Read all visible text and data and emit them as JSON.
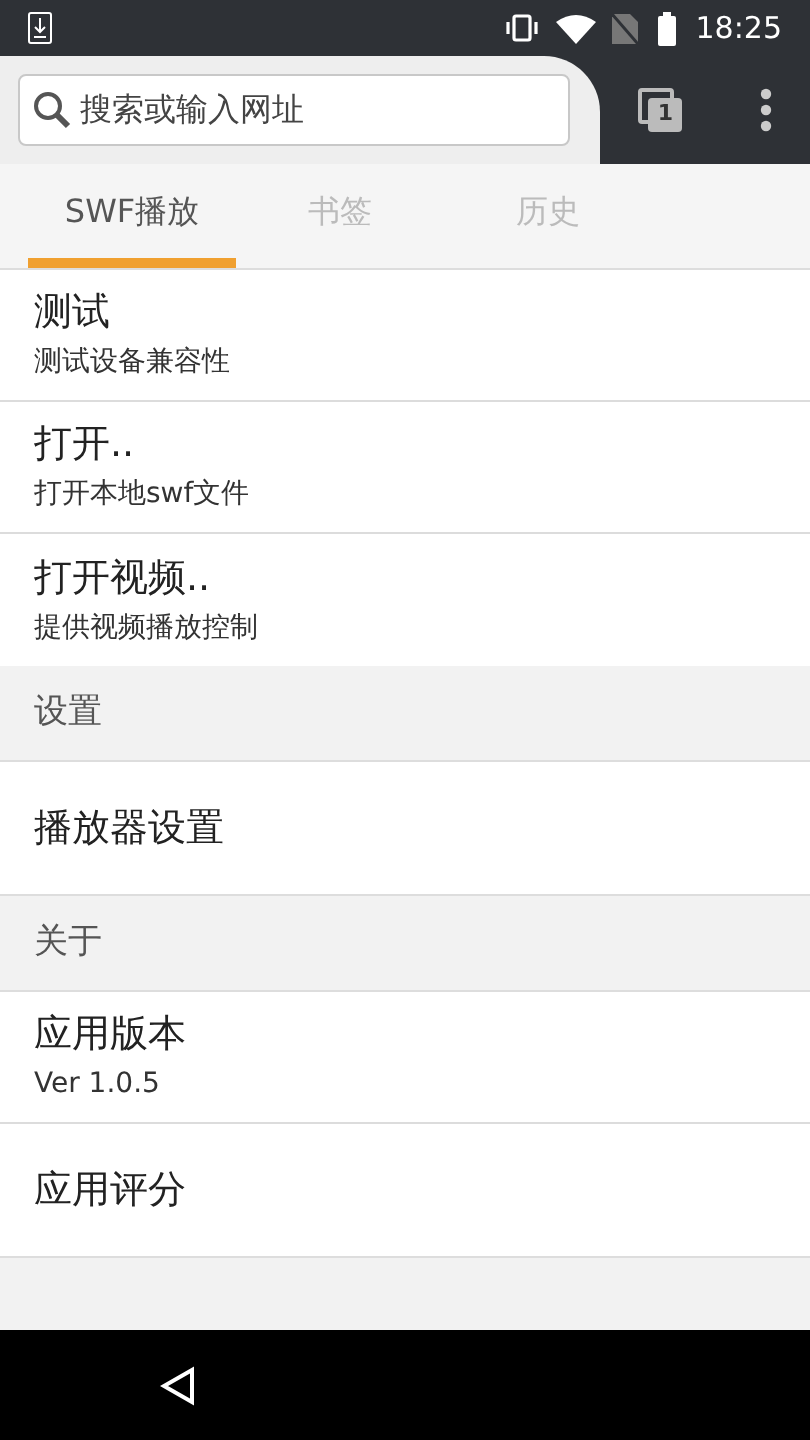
{
  "status_bar": {
    "time": "18:25"
  },
  "search": {
    "placeholder": "搜索或输入网址"
  },
  "tab_counter": "1",
  "tabs": [
    {
      "label": "SWF播放",
      "selected": true
    },
    {
      "label": "书签",
      "selected": false
    },
    {
      "label": "历史",
      "selected": false
    }
  ],
  "items": [
    {
      "title": "测试",
      "subtitle": "测试设备兼容性"
    },
    {
      "title": "打开..",
      "subtitle": "打开本地swf文件"
    },
    {
      "title": "打开视频..",
      "subtitle": "提供视频播放控制"
    }
  ],
  "sections": [
    {
      "header": "设置",
      "items": [
        {
          "title": "播放器设置"
        }
      ]
    },
    {
      "header": "关于",
      "items": [
        {
          "title": "应用版本",
          "subtitle": "Ver 1.0.5"
        },
        {
          "title": "应用评分"
        }
      ]
    }
  ]
}
